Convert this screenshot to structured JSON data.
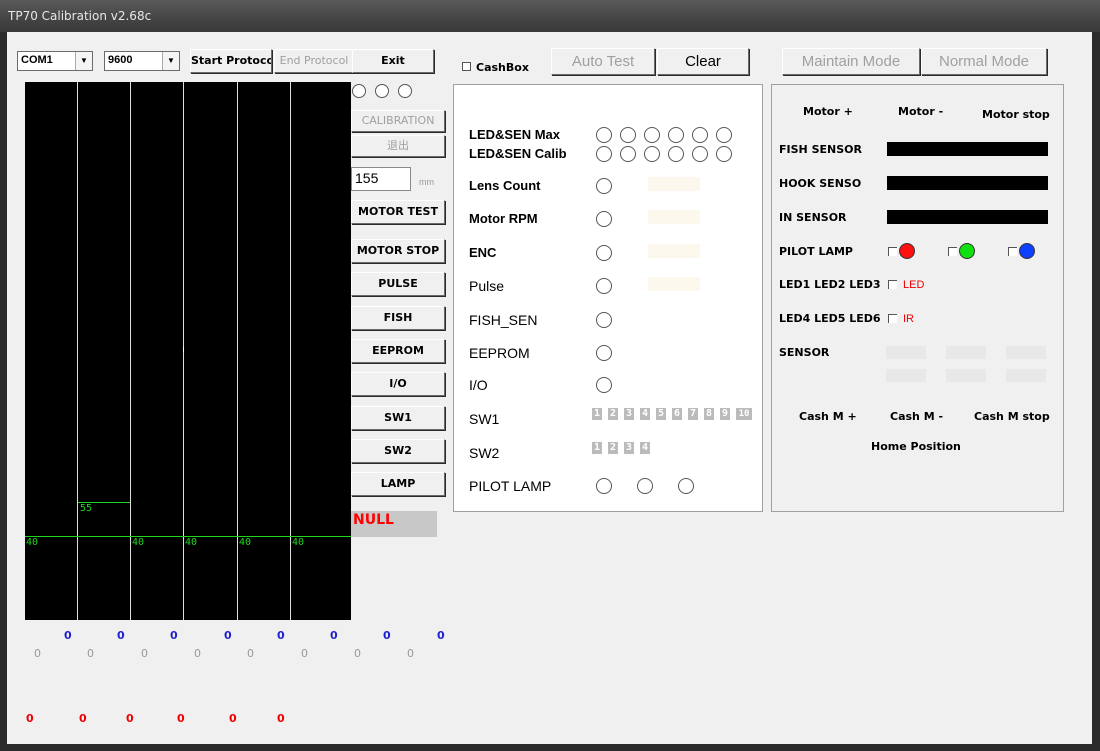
{
  "window": {
    "title": "TP70 Calibration v2.68c"
  },
  "toolbar": {
    "com_port": "COM1",
    "baud": "9600",
    "start_protocol": "Start Protoco",
    "end_protocol": "End Protocol",
    "exit": "Exit",
    "cashbox_label": "CashBox",
    "auto_test": "Auto Test",
    "clear": "Clear",
    "maintain_mode": "Maintain Mode",
    "normal_mode": "Normal Mode"
  },
  "left_buttons": {
    "calibration": "CALIBRATION",
    "exit_cn": "退出",
    "mm_value": "155",
    "mm_unit": "mm",
    "motor_test": "MOTOR TEST",
    "motor_stop": "MOTOR STOP",
    "pulse": "PULSE",
    "fish": "FISH",
    "eeprom": "EEPROM",
    "io": "I/O",
    "sw1": "SW1",
    "sw2": "SW2",
    "lamp": "LAMP",
    "status": "NULL"
  },
  "graph": {
    "bars": [
      {
        "value": "40"
      },
      {
        "value": "55"
      },
      {
        "value": "40"
      },
      {
        "value": "40"
      },
      {
        "value": "40"
      },
      {
        "value": "40"
      }
    ],
    "blue_row": [
      "0",
      "0",
      "0",
      "0",
      "0",
      "0",
      "0",
      "0"
    ],
    "gray_row": [
      "0",
      "0",
      "0",
      "0",
      "0",
      "0",
      "0",
      "0"
    ],
    "red_row": [
      "0",
      "0",
      "0",
      "0",
      "0",
      "0"
    ]
  },
  "center_panel": {
    "rows": {
      "led_max": "LED&SEN Max",
      "led_calib": "LED&SEN Calib",
      "lens_count": "Lens Count",
      "motor_rpm": "Motor RPM",
      "enc": "ENC",
      "pulse": "Pulse",
      "fish_sen": "FISH_SEN",
      "eeprom": "EEPROM",
      "io": "I/O",
      "sw1": "SW1",
      "sw2": "SW2",
      "pilot_lamp": "PILOT LAMP"
    },
    "sw1_numbers": [
      "1",
      "2",
      "3",
      "4",
      "5",
      "6",
      "7",
      "8",
      "9",
      "10"
    ],
    "sw2_numbers": [
      "1",
      "2",
      "3",
      "4"
    ]
  },
  "right_panel": {
    "motor_plus": "Motor +",
    "motor_minus": "Motor -",
    "motor_stop": "Motor stop",
    "fish_sensor": "FISH SENSOR",
    "hook_sensor": "HOOK SENSO",
    "in_sensor": "IN SENSOR",
    "pilot_lamp": "PILOT LAMP",
    "led123": "LED1 LED2 LED3",
    "led_label": "LED",
    "led456": "LED4 LED5 LED6",
    "ir_label": "IR",
    "sensor": "SENSOR",
    "cash_m_plus": "Cash M +",
    "cash_m_minus": "Cash M -",
    "cash_m_stop": "Cash M stop",
    "home_position": "Home Position"
  },
  "colors": {
    "lamp_red": "#ff1010",
    "lamp_green": "#10e010",
    "lamp_blue": "#1040ff",
    "graph_line": "#1fd61f",
    "status_red": "#ff0000"
  }
}
